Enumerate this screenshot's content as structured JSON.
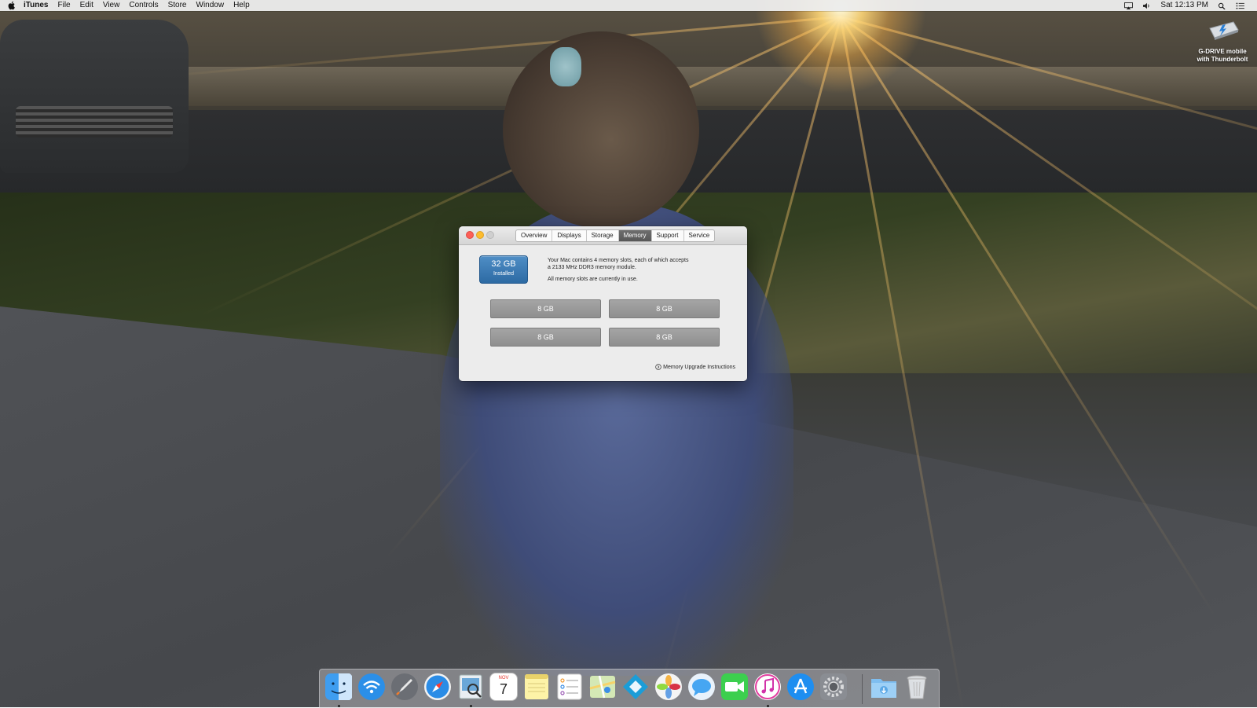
{
  "menubar": {
    "app_name": "iTunes",
    "menus": [
      "File",
      "Edit",
      "View",
      "Controls",
      "Store",
      "Window",
      "Help"
    ],
    "clock": "Sat 12:13 PM",
    "status_icons": [
      "airplay-icon",
      "volume-icon",
      "search-icon",
      "list-icon"
    ]
  },
  "desktop": {
    "drive": {
      "line1": "G-DRIVE mobile",
      "line2": "with Thunderbolt"
    }
  },
  "window": {
    "tabs": [
      {
        "label": "Overview",
        "active": false
      },
      {
        "label": "Displays",
        "active": false
      },
      {
        "label": "Storage",
        "active": false
      },
      {
        "label": "Memory",
        "active": true
      },
      {
        "label": "Support",
        "active": false
      },
      {
        "label": "Service",
        "active": false
      }
    ],
    "memory": {
      "installed_size": "32 GB",
      "installed_label": "Installed",
      "description_line1": "Your Mac contains 4 memory slots, each of which accepts",
      "description_line2": "a 2133 MHz DDR3 memory module.",
      "status": "All memory slots are currently in use.",
      "slots": [
        "8 GB",
        "8 GB",
        "8 GB",
        "8 GB"
      ],
      "upgrade_link": "Memory Upgrade Instructions"
    }
  },
  "dock": {
    "items": [
      "finder-icon",
      "wifi-icon",
      "launchpad-icon",
      "safari-icon",
      "preview-icon",
      "calendar-icon",
      "notes-icon",
      "reminders-icon",
      "maps-icon",
      "kodi-icon",
      "photos-icon",
      "messages-icon",
      "facetime-icon",
      "itunes-icon",
      "app-store-icon",
      "system-preferences-icon",
      "downloads-folder-icon",
      "trash-icon"
    ],
    "calendar_month": "NOV",
    "calendar_day": "7"
  }
}
